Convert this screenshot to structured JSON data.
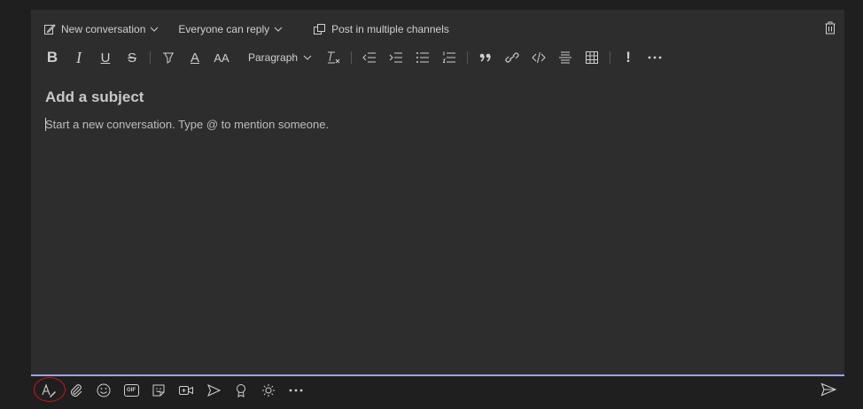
{
  "header": {
    "new_conversation": "New conversation",
    "reply_setting": "Everyone can reply",
    "post_multiple": "Post in multiple channels"
  },
  "format_toolbar": {
    "bold": "B",
    "italic": "I",
    "underline": "U",
    "strike": "S",
    "font_color": "A",
    "font_size": "AA",
    "paragraph": "Paragraph",
    "important": "!"
  },
  "compose": {
    "subject_placeholder": "Add a subject",
    "body_placeholder": "Start a new conversation. Type @ to mention someone."
  },
  "bottom_toolbar": {
    "gif": "GIF"
  },
  "colors": {
    "background": "#1f1f1f",
    "panel": "#2d2d2d",
    "accent_underline": "#9fa3e6",
    "highlight_ring": "#d0141c"
  }
}
